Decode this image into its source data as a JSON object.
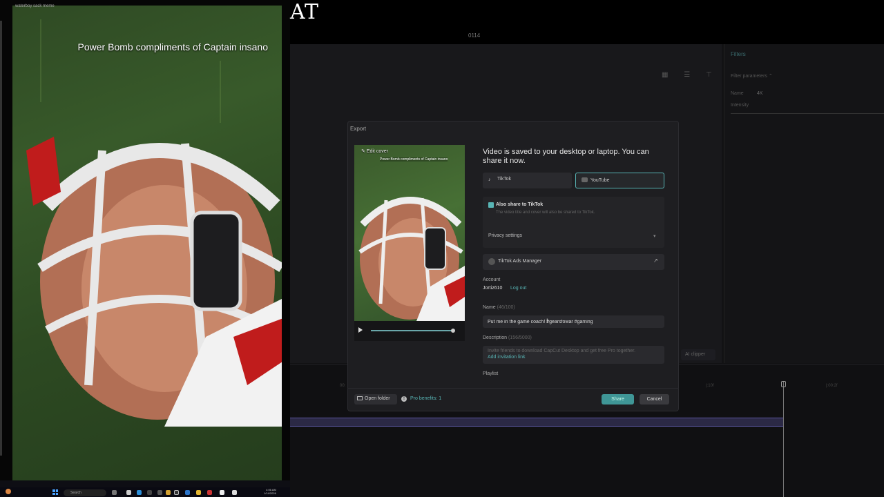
{
  "video": {
    "caption": "Power Bomb compliments of Captain insano",
    "topline": "waterboy sack meme"
  },
  "top": {
    "logo_text": "AT",
    "timecode": "0114"
  },
  "editor": {
    "filters_tab": "Filters",
    "filter_params": "Filter parameters ⌃",
    "name_label": "Name",
    "name_value": "4K",
    "intensity_label": "Intensity",
    "ai_clipper": "AI clipper",
    "ticks": [
      "00:",
      "|:10f",
      "|:00:2f"
    ]
  },
  "export": {
    "title": "Export",
    "edit_cover": "Edit cover",
    "thumb_caption": "Power Bomb compliments of Captain insano",
    "save_message": "Video is saved to your desktop or laptop. You can share it now.",
    "tiktok": "TikTok",
    "youtube": "YouTube",
    "also_share": "Also share to TikTok",
    "also_share_desc": "The video title and cover will also be shared to TikTok.",
    "privacy": "Privacy settings",
    "ads_manager": "TikTok Ads Manager",
    "account_label": "Account",
    "account_user": "Jortiz610",
    "logout": "Log out",
    "name_label": "Name",
    "name_count": "(46/100)",
    "name_value": "Put me in the game coach! #gearsfowar #gaming",
    "desc_label": "Description",
    "desc_count": "(156/5000)",
    "desc_text": "Invite friends to download CapCut Desktop and get free Pro together.",
    "desc_link": "Add invitation link",
    "playlist": "Playlist",
    "open_folder": "Open folder",
    "pro_benefits": "Pro benefits: 1",
    "share": "Share",
    "cancel": "Cancel"
  },
  "taskbar": {
    "search": "Search",
    "time": "4:06 AM",
    "date": "1/14/2026"
  },
  "colors": {
    "accent": "#58b5b5",
    "share_button": "#3f9696",
    "timeline_clip": "#2b2945"
  },
  "icons": [
    "play-icon",
    "tiktok-icon",
    "youtube-icon",
    "external-link-icon",
    "folder-icon",
    "info-icon",
    "chevron-down-icon",
    "windows-start-icon",
    "search-icon"
  ]
}
